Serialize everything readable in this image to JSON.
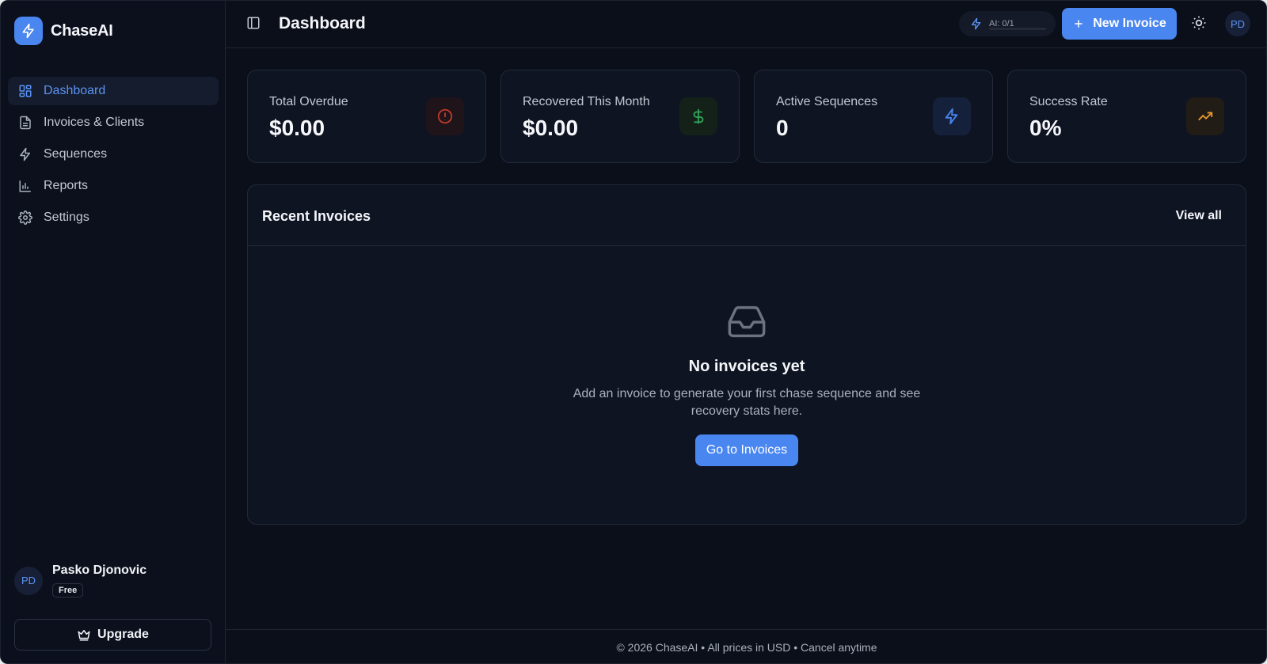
{
  "brand": {
    "name": "ChaseAI"
  },
  "sidebar": {
    "items": [
      {
        "label": "Dashboard",
        "icon": "dashboard-grid-icon",
        "active": true
      },
      {
        "label": "Invoices & Clients",
        "icon": "document-icon",
        "active": false
      },
      {
        "label": "Sequences",
        "icon": "lightning-icon",
        "active": false
      },
      {
        "label": "Reports",
        "icon": "bar-chart-icon",
        "active": false
      },
      {
        "label": "Settings",
        "icon": "gear-icon",
        "active": false
      }
    ],
    "user": {
      "initials": "PD",
      "name": "Pasko Djonovic",
      "plan": "Free"
    },
    "upgrade_label": "Upgrade"
  },
  "header": {
    "title": "Dashboard",
    "ai_usage": "AI: 0/1",
    "new_invoice_label": "New Invoice",
    "avatar_initials": "PD"
  },
  "stats": [
    {
      "label": "Total Overdue",
      "value": "$0.00",
      "icon": "alert-circle-icon",
      "color": "#c0392b"
    },
    {
      "label": "Recovered This Month",
      "value": "$0.00",
      "icon": "dollar-icon",
      "color": "#2fa45a"
    },
    {
      "label": "Active Sequences",
      "value": "0",
      "icon": "lightning-icon",
      "color": "#4a86f0"
    },
    {
      "label": "Success Rate",
      "value": "0%",
      "icon": "trending-up-icon",
      "color": "#e59a2b"
    }
  ],
  "recent": {
    "title": "Recent Invoices",
    "view_all_label": "View all",
    "empty_title": "No invoices yet",
    "empty_desc": "Add an invoice to generate your first chase sequence and see recovery stats here.",
    "goto_label": "Go to Invoices"
  },
  "footer": {
    "text": "© 2026 ChaseAI • All prices in USD • Cancel anytime"
  },
  "colors": {
    "accent": "#4a86f0",
    "background": "#0a0f1a",
    "card": "#0e1422"
  }
}
